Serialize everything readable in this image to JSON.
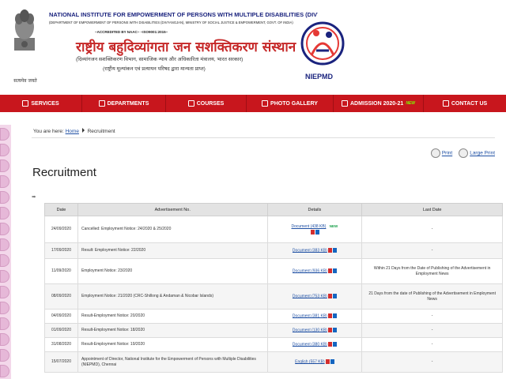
{
  "header": {
    "institute_title": "NATIONAL INSTITUTE FOR EMPOWERMENT OF PERSONS WITH MULTIPLE DISABILITIES (DIVYANGJAN)",
    "institute_sub": "(DEPARTMENT OF EMPOWERMENT OF PERSONS WITH DISABILITIES (DIVYANGJAN), MINISTRY OF SOCIAL JUSTICE & EMPOWERMENT, GOVT. OF INDIA)",
    "accreditation": "~ACCREDITED BY NAAC~   ~ISO9001:2015~",
    "hindi_title": "राष्ट्रीय बहुदिव्यांगता जन सशक्तिकरण संस्थान",
    "hindi_sub1": "(दिव्यांगजन सशक्तिकरण विभाग, सामाजिक न्याय और अधिकारिता मंत्रालय, भारत सरकार)",
    "hindi_sub2": "(राष्ट्रीय मूल्यांकन एवं प्रत्यायन परिषद द्वारा मान्यता प्राप्त)",
    "emblem_motto": "सत्यमेव जयते",
    "logo_text": "NIEPMD"
  },
  "nav": [
    {
      "label": "SERVICES",
      "icon": "services-icon"
    },
    {
      "label": "DEPARTMENTS",
      "icon": "departments-icon"
    },
    {
      "label": "COURSES",
      "icon": "courses-icon"
    },
    {
      "label": "PHOTO GALLERY",
      "icon": "gallery-icon"
    },
    {
      "label": "ADMISSION 2020-21",
      "icon": "admission-icon",
      "badge": "NEW"
    },
    {
      "label": "CONTACT US",
      "icon": "contact-icon"
    }
  ],
  "breadcrumb": {
    "prefix": "You are here:",
    "home": "Home",
    "current": "Recruitment"
  },
  "print": {
    "print_label": "Print",
    "large_print_label": "Large Print"
  },
  "page_title": "Recruitment",
  "table": {
    "headers": [
      "Date",
      "Advertisement No.",
      "Details",
      "Last Date"
    ],
    "rows": [
      {
        "date": "24/09/2020",
        "adv": "Cancelled: Employment Notice: 24/2020 & 25/2020",
        "details": "Document (438 KB)",
        "new": "NEW",
        "last": "-"
      },
      {
        "date": "17/09/2020",
        "adv": "Result: Employment Notice: 22/2020",
        "details": "Document (383 KB)",
        "last": "-"
      },
      {
        "date": "11/09/2020",
        "adv": "Employment Notice: 23/2020",
        "details": "Document (936 KB)",
        "last": "Within 21 Days from the Date of Publishing of the Advertisement in Employment News"
      },
      {
        "date": "08/09/2020",
        "adv": "Employment Notice: 21/2020 (CRC-Shillong & Andaman & Nicobar Islands)",
        "details": "Document (753 KB)",
        "last": "21 Days from the date of Publishing of the Advertisement in Employment News"
      },
      {
        "date": "04/09/2020",
        "adv": "Result-Employment Notice: 20/2020",
        "details": "Document (381 KB)",
        "last": "-"
      },
      {
        "date": "01/09/2020",
        "adv": "Result-Employment Notice: 18/2020",
        "details": "Document (130 KB)",
        "last": "-"
      },
      {
        "date": "31/08/2020",
        "adv": "Result-Employment Notice: 19/2020",
        "details": "Document (380 KB)",
        "last": "-"
      },
      {
        "date": "15/07/2020",
        "adv": "Appointment of Director, National Institute for the Empowerment of Persons with Multiple Disabilities (NIEPMD), Chennai",
        "details": "English (557 KB)",
        "last": "-"
      }
    ]
  },
  "colors": {
    "nav_bg": "#c8161d",
    "title_blue": "#1a237e",
    "hindi_red": "#c62828",
    "link_blue": "#1e4fa3",
    "rail_pink": "#f3d7ea"
  }
}
